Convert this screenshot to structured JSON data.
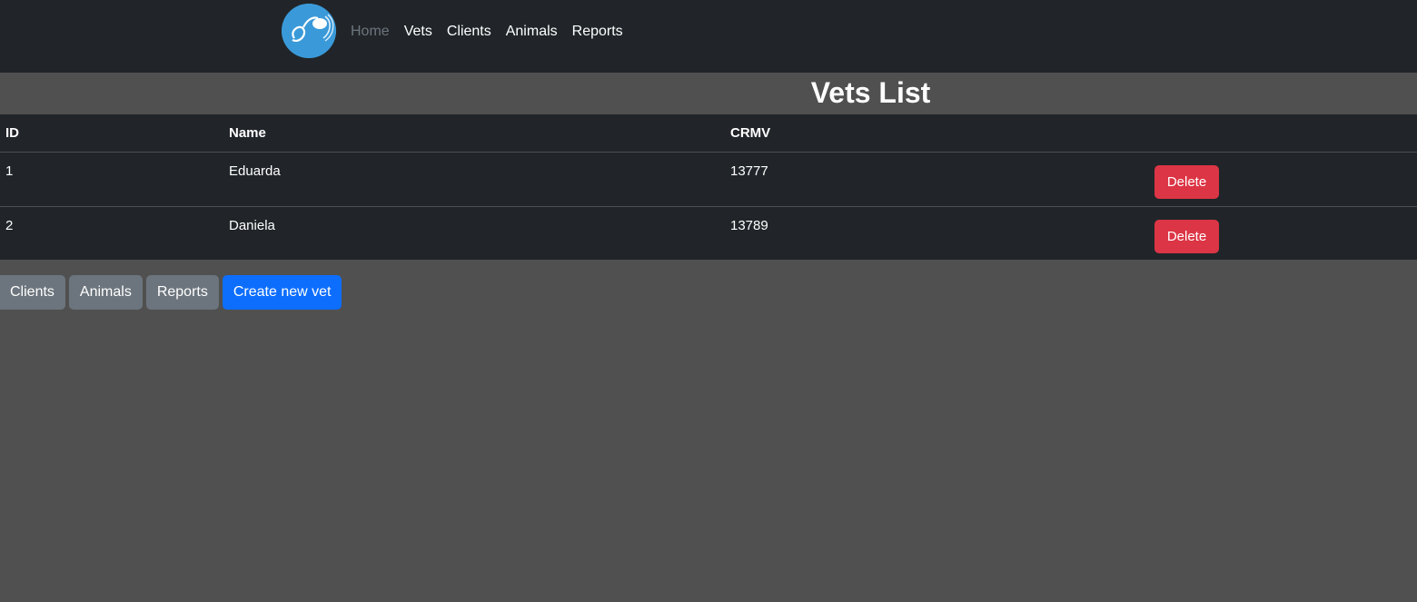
{
  "nav": {
    "logo_icon": "stethoscope-logo-icon",
    "links": [
      {
        "label": "Home",
        "muted": true
      },
      {
        "label": "Vets"
      },
      {
        "label": "Clients"
      },
      {
        "label": "Animals"
      },
      {
        "label": "Reports"
      }
    ]
  },
  "page": {
    "title": "Vets List"
  },
  "table": {
    "headers": [
      "ID",
      "Name",
      "CRMV",
      ""
    ],
    "rows": [
      {
        "id": "1",
        "name": "Eduarda",
        "crmv": "13777",
        "action": "Delete"
      },
      {
        "id": "2",
        "name": "Daniela",
        "crmv": "13789",
        "action": "Delete"
      }
    ]
  },
  "actions": {
    "clients": "Clients",
    "animals": "Animals",
    "reports": "Reports",
    "create": "Create new vet"
  },
  "colors": {
    "navbar": "#212529",
    "background": "#505050",
    "primary": "#0d6efd",
    "secondary": "#6c757d",
    "danger": "#dc3545",
    "logo": "#3a9ad9"
  }
}
